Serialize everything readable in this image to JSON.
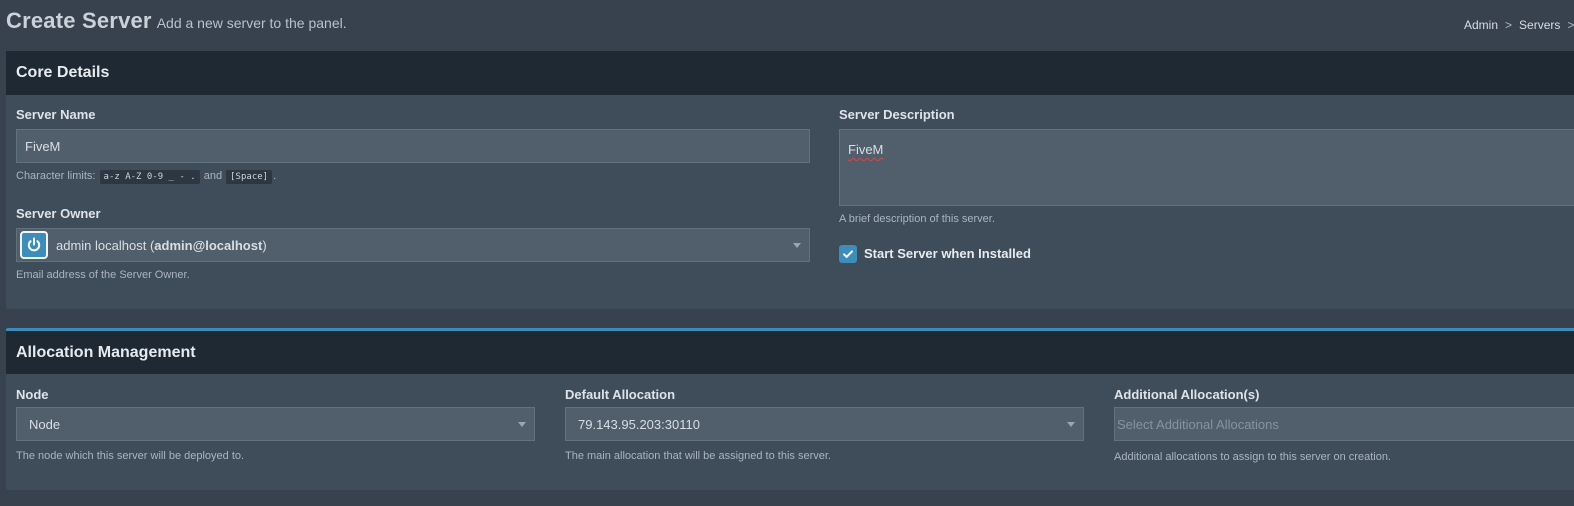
{
  "header": {
    "title": "Create Server",
    "subtitle": "Add a new server to the panel."
  },
  "breadcrumb": [
    "Admin",
    "Servers",
    ""
  ],
  "core": {
    "title": "Core Details",
    "server_name": {
      "label": "Server Name",
      "value": "FiveM",
      "help_prefix": "Character limits:",
      "code1": "a-z A-Z 0-9 _ - .",
      "help_and": "and",
      "code2": "[Space]",
      "help_suffix": "."
    },
    "server_owner": {
      "label": "Server Owner",
      "value_name": "admin localhost (",
      "value_email": "admin@localhost",
      "value_close": ")",
      "help": "Email address of the Server Owner."
    },
    "server_description": {
      "label": "Server Description",
      "value": "FiveM",
      "help": "A brief description of this server."
    },
    "start_when_installed": {
      "label": "Start Server when Installed",
      "checked": true
    }
  },
  "allocation": {
    "title": "Allocation Management",
    "node": {
      "label": "Node",
      "value": "Node",
      "help": "The node which this server will be deployed to."
    },
    "default_allocation": {
      "label": "Default Allocation",
      "value": "79.143.95.203:30110",
      "help": "The main allocation that will be assigned to this server."
    },
    "additional_allocations": {
      "label": "Additional Allocation(s)",
      "placeholder": "Select Additional Allocations",
      "help": "Additional allocations to assign to this server on creation."
    }
  },
  "colors": {
    "accent": "#3c8dbc",
    "box_header": "#1f2933",
    "box_body": "#3f4d5a",
    "page_bg": "#37424e"
  },
  "icons": {
    "avatar": "power-icon",
    "checkbox": "check-icon",
    "select": "caret-down-icon"
  }
}
